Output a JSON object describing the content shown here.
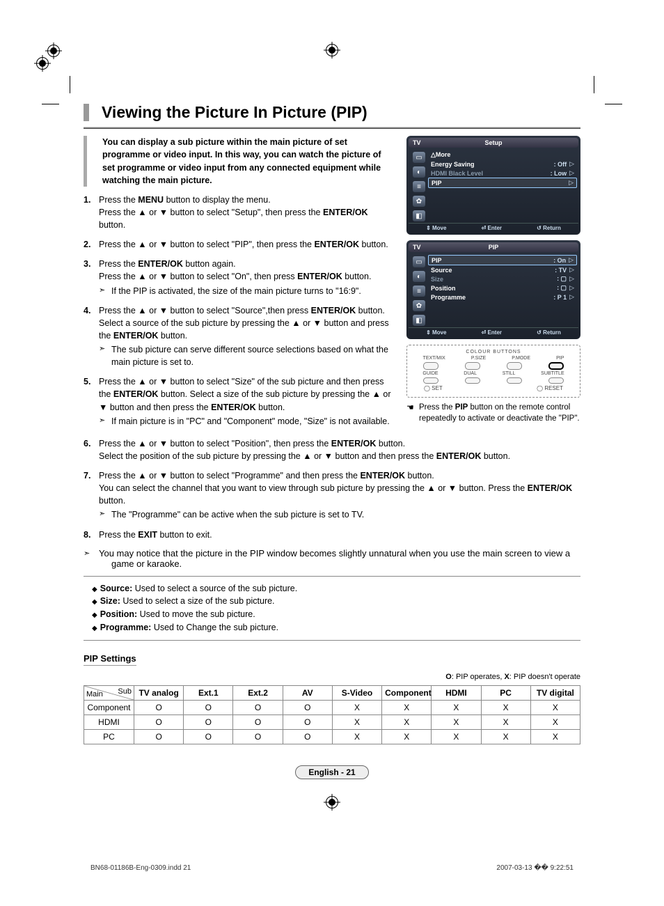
{
  "title": "Viewing the Picture In Picture (PIP)",
  "intro": "You can display a sub picture within the main picture of set programme or video input. In this way, you can watch the picture of set programme or video input from any connected equipment while watching the main picture.",
  "steps": [
    {
      "num": "1.",
      "html": "Press the <b>MENU</b> button to display the menu.<br>Press the ▲ or ▼ button to select \"Setup\", then press the <b>ENTER/OK</b> button."
    },
    {
      "num": "2.",
      "html": "Press the ▲ or ▼ button to select \"PIP\", then press the <b>ENTER/OK</b> button."
    },
    {
      "num": "3.",
      "html": "Press the <b>ENTER/OK</b> button again.<br>Press the ▲ or ▼ button to select \"On\", then press <b>ENTER/OK</b> button.",
      "note": "If the PIP is activated, the size of the main picture turns to \"16:9\"."
    },
    {
      "num": "4.",
      "html": "Press the ▲ or ▼ button to select \"Source\",then press <b>ENTER/OK</b> button. Select a source of the sub picture by pressing the ▲ or ▼ button and press the <b>ENTER/OK</b> button.",
      "note": "The sub picture can serve different source selections based on what the main picture is set to."
    },
    {
      "num": "5.",
      "html": "Press the ▲ or ▼ button to select \"Size\" of the sub picture and then press the <b>ENTER/OK</b> button. Select a size of the sub picture by pressing the ▲ or ▼ button and then press the <b>ENTER/OK</b> button.",
      "note": "If main picture is in \"PC\" and \"Component\" mode, \"Size\" is not available."
    }
  ],
  "steps_full": [
    {
      "num": "6.",
      "html": "Press the ▲ or ▼ button to select \"Position\", then press the <b>ENTER/OK</b> button.<br>Select the position of the sub picture by pressing the ▲ or ▼ button and then press the <b>ENTER/OK</b> button."
    },
    {
      "num": "7.",
      "html": "Press the ▲ or ▼ button to select \"Programme\" and then press the <b>ENTER/OK</b> button.<br>You can select the channel that you want to view through sub picture by pressing the ▲ or ▼ button. Press the <b>ENTER/OK</b> button.",
      "note": "The \"Programme\" can be active when the sub picture is set to TV."
    },
    {
      "num": "8.",
      "html": "Press the <b>EXIT</b> button to exit."
    }
  ],
  "closing_note": "You may notice that the picture in the PIP window becomes slightly unnatural when you use the main screen to view a game or karaoke.",
  "defs": [
    {
      "term": "Source:",
      "text": "Used to select a source of the sub picture."
    },
    {
      "term": "Size:",
      "text": "Used to select a size of the sub picture."
    },
    {
      "term": "Position:",
      "text": "Used to move the sub picture."
    },
    {
      "term": "Programme:",
      "text": "Used to Change the sub picture."
    }
  ],
  "settings_heading": "PIP Settings",
  "legend": "O: PIP operates, X: PIP doesn't operate",
  "table": {
    "corner_main": "Main",
    "corner_sub": "Sub",
    "headers": [
      "TV analog",
      "Ext.1",
      "Ext.2",
      "AV",
      "S-Video",
      "Component",
      "HDMI",
      "PC",
      "TV digital"
    ],
    "rows": [
      {
        "name": "Component",
        "cells": [
          "O",
          "O",
          "O",
          "O",
          "X",
          "X",
          "X",
          "X",
          "X"
        ]
      },
      {
        "name": "HDMI",
        "cells": [
          "O",
          "O",
          "O",
          "O",
          "X",
          "X",
          "X",
          "X",
          "X"
        ]
      },
      {
        "name": "PC",
        "cells": [
          "O",
          "O",
          "O",
          "O",
          "X",
          "X",
          "X",
          "X",
          "X"
        ]
      }
    ]
  },
  "osd1": {
    "tag": "TV",
    "title": "Setup",
    "lines": [
      {
        "label": "△More",
        "val": "",
        "sel": false,
        "cls": ""
      },
      {
        "label": "Energy Saving",
        "val": ": Off",
        "sel": false,
        "arrow": "▷"
      },
      {
        "label": "HDMI Black Level",
        "val": ": Low",
        "sel": false,
        "arrow": "▷",
        "cls": "dim"
      },
      {
        "label": "PIP",
        "val": "",
        "sel": true,
        "arrow": "▷"
      }
    ],
    "footer": [
      "⇕ Move",
      "⏎ Enter",
      "↺ Return"
    ]
  },
  "osd2": {
    "tag": "TV",
    "title": "PIP",
    "lines": [
      {
        "label": "PIP",
        "val": ": On",
        "sel": true,
        "arrow": "▷"
      },
      {
        "label": "Source",
        "val": ": TV",
        "sel": false,
        "arrow": "▷"
      },
      {
        "label": "Size",
        "val": ": ▢",
        "sel": false,
        "arrow": "▷",
        "cls": "dim"
      },
      {
        "label": "Position",
        "val": ": ▢",
        "sel": false,
        "arrow": "▷"
      },
      {
        "label": "Programme",
        "val": ": P 1",
        "sel": false,
        "arrow": "▷"
      }
    ],
    "footer": [
      "⇕ Move",
      "⏎ Enter",
      "↺ Return"
    ]
  },
  "remote": {
    "header": "COLOUR BUTTONS",
    "row1": [
      "TEXT/MIX",
      "P.SIZE",
      "P.MODE",
      "PIP"
    ],
    "row2": [
      "GUIDE",
      "DUAL",
      "STILL",
      "SUBTITLE"
    ],
    "footer_l": "◯ SET",
    "footer_r": "◯ RESET"
  },
  "remote_note": "Press the PIP button on the remote control repeatedly to activate or deactivate the \"PIP\".",
  "remote_note_bold": "PIP",
  "page_num": "English - 21",
  "footer_left": "BN68-01186B-Eng-0309.indd   21",
  "footer_right": "2007-03-13   �� 9:22:51"
}
